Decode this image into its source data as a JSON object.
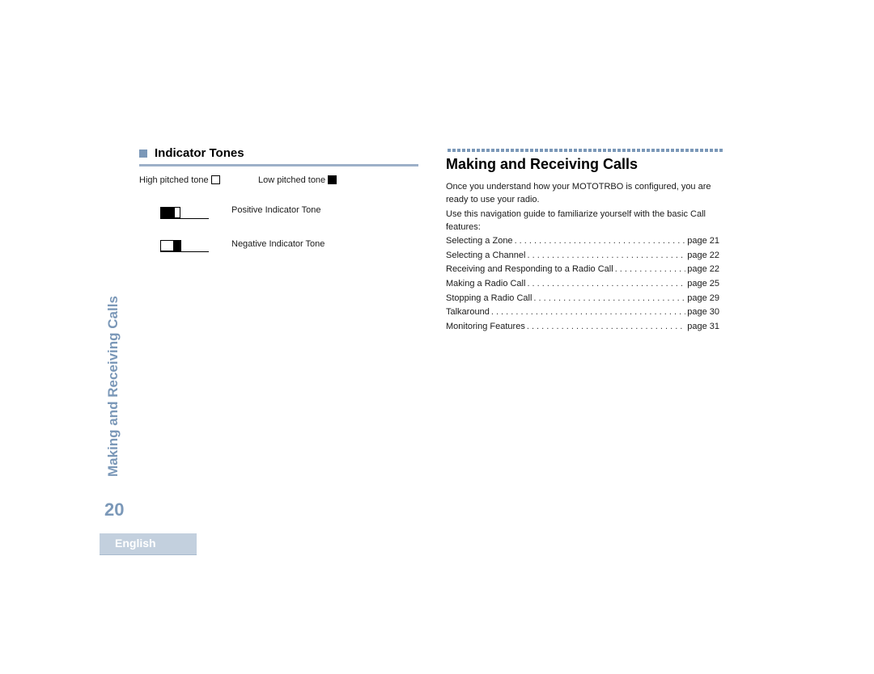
{
  "side_title": "Making and Receiving Calls",
  "page_number": "20",
  "language_tab": "English",
  "left_section": {
    "heading": "Indicator Tones",
    "legend": {
      "high": "High pitched tone",
      "low": "Low pitched tone"
    },
    "tones": [
      {
        "label": "Positive Indicator Tone",
        "pattern": [
          "low",
          "high"
        ]
      },
      {
        "label": "Negative Indicator Tone",
        "pattern": [
          "high",
          "low"
        ]
      }
    ]
  },
  "right_section": {
    "title": "Making and Receiving Calls",
    "intro": "Once you understand how your MOTOTRBO  is configured, you are ready to use your radio.",
    "guide_text": "Use this navigation guide to familiarize yourself with the basic Call features:",
    "toc": [
      {
        "label": "Selecting a Zone",
        "page": "page 21"
      },
      {
        "label": "Selecting a Channel",
        "page": "page 22"
      },
      {
        "label": "Receiving and Responding to a Radio Call",
        "page": "page 22"
      },
      {
        "label": "Making a Radio Call",
        "page": "page 25"
      },
      {
        "label": "Stopping a Radio Call",
        "page": "page 29"
      },
      {
        "label": "Talkaround",
        "page": "page 30"
      },
      {
        "label": "Monitoring Features",
        "page": "page 31"
      }
    ]
  }
}
